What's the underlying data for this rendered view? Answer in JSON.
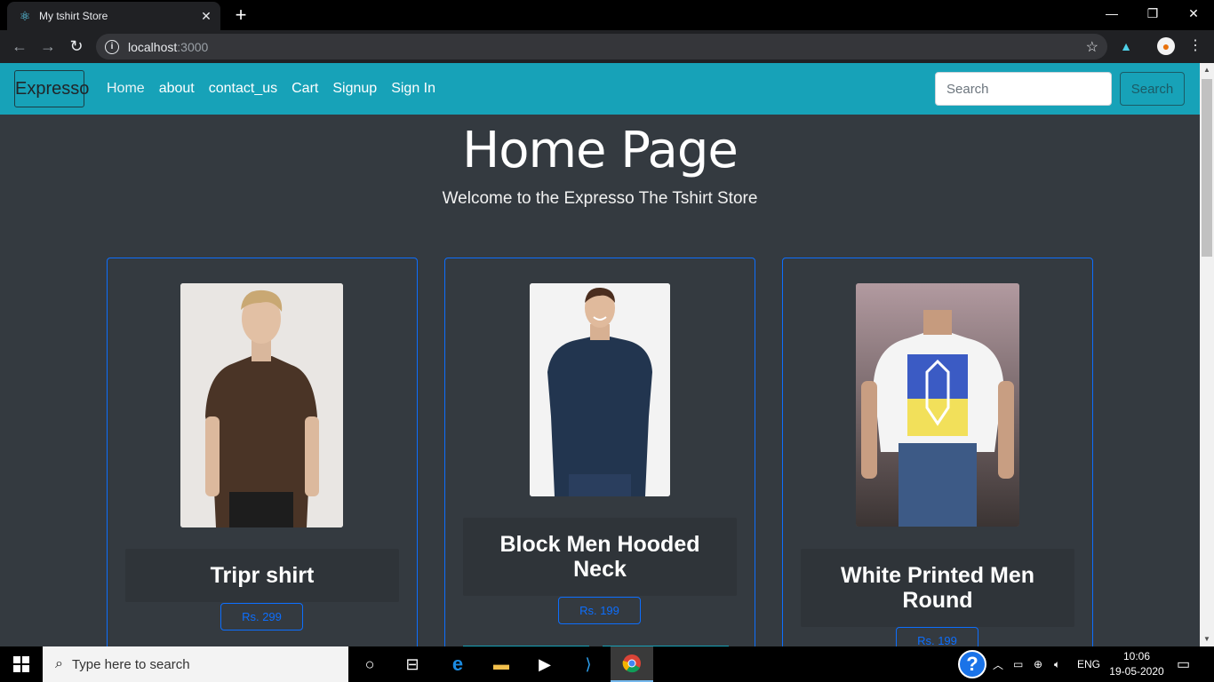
{
  "browser": {
    "tab_title": "My tshirt Store",
    "tab_close": "✕",
    "new_tab": "+",
    "url_host": "localhost",
    "url_port": ":3000",
    "window_minimize": "—",
    "window_restore": "❐",
    "window_close": "✕"
  },
  "navbar": {
    "brand": "Expresso",
    "links": [
      "Home",
      "about",
      "contact_us",
      "Cart",
      "Signup",
      "Sign In"
    ],
    "search_placeholder": "Search",
    "search_button": "Search",
    "accent_color": "#17a2b8"
  },
  "hero": {
    "title": "Home Page",
    "subtitle": "Welcome to the Expresso The Tshirt Store"
  },
  "products": [
    {
      "name": "Tripr shirt",
      "price": "Rs. 299"
    },
    {
      "name": "Block Men Hooded Neck",
      "price": "Rs. 199"
    },
    {
      "name": "White Printed Men Round",
      "price": "Rs. 199"
    }
  ],
  "taskbar": {
    "search_placeholder": "Type here to search",
    "language": "ENG",
    "time": "10:06",
    "date": "19-05-2020"
  }
}
